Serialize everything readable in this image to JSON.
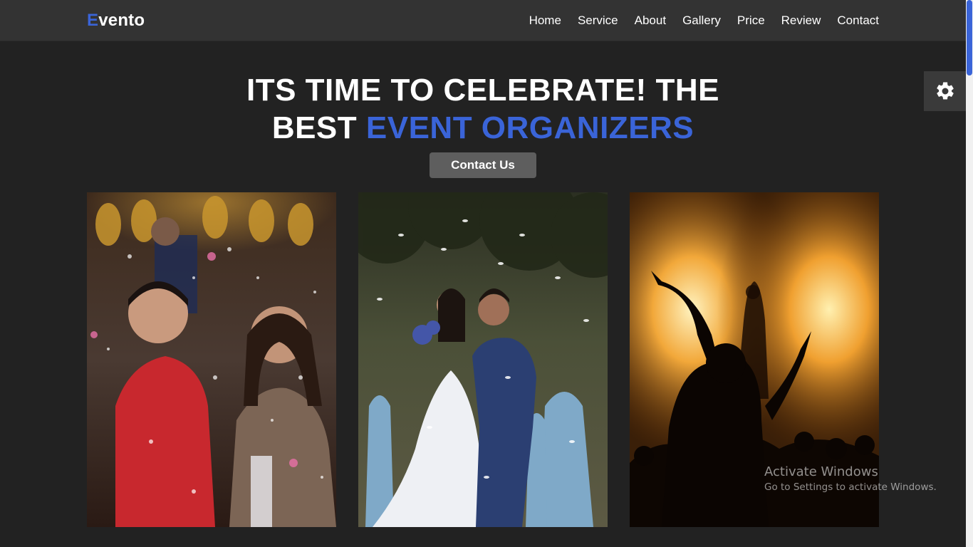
{
  "brand": {
    "initial": "E",
    "rest": "vento",
    "accent_color": "#3a64d8"
  },
  "nav": {
    "items": [
      {
        "label": "Home"
      },
      {
        "label": "Service"
      },
      {
        "label": "About"
      },
      {
        "label": "Gallery"
      },
      {
        "label": "Price"
      },
      {
        "label": "Review"
      },
      {
        "label": "Contact"
      }
    ]
  },
  "hero": {
    "title_line1": "ITS TIME TO CELEBRATE! THE",
    "title_line2_plain": "BEST ",
    "title_line2_accent": "EVENT ORGANIZERS",
    "cta_label": "Contact Us"
  },
  "gallery": {
    "images": [
      {
        "icon": "birthday-party-photo"
      },
      {
        "icon": "wedding-photo"
      },
      {
        "icon": "concert-photo"
      }
    ]
  },
  "settings": {
    "icon": "gear-icon"
  },
  "watermark": {
    "title": "Activate Windows",
    "subtitle": "Go to Settings to activate Windows."
  }
}
